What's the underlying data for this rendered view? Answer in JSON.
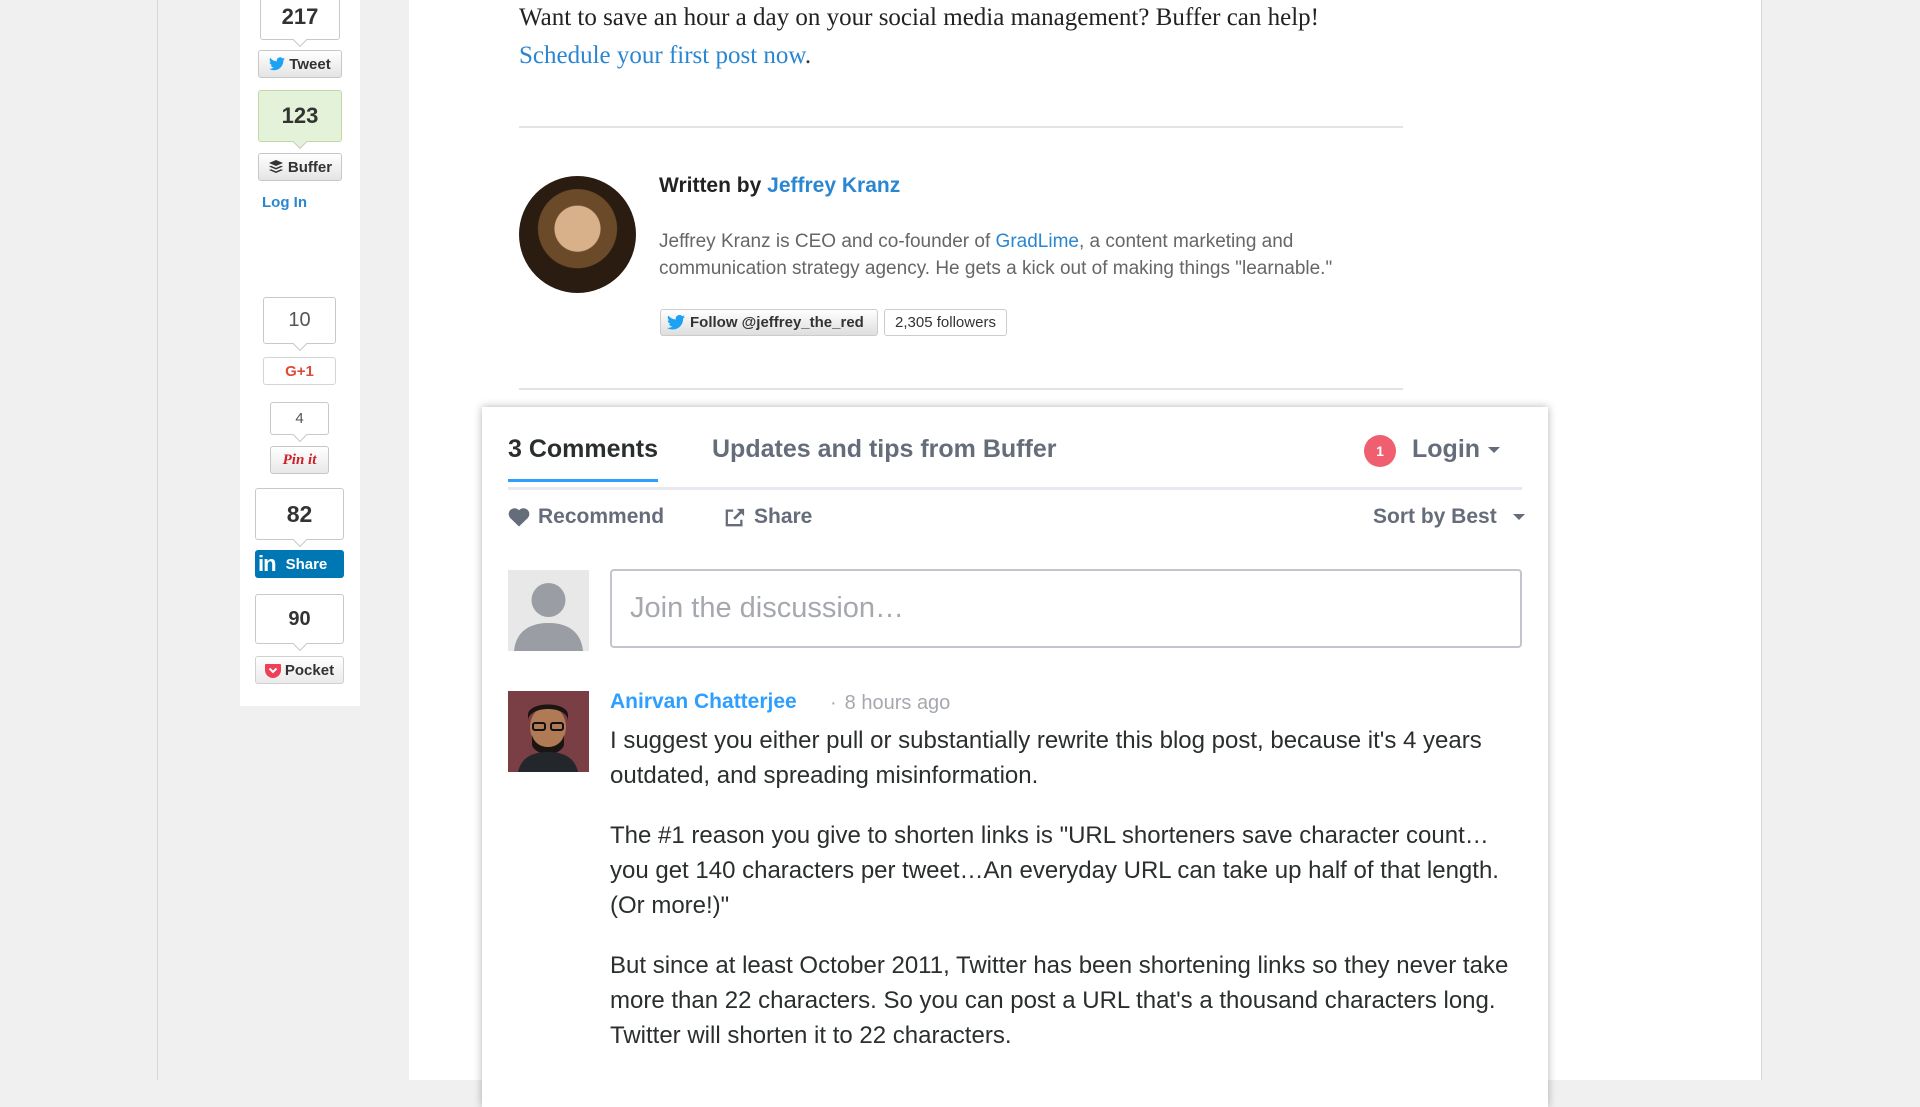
{
  "share_bar": {
    "twitter_count": "217",
    "twitter_label": "Tweet",
    "buffer_count": "123",
    "buffer_label": "Buffer",
    "login_label": "Log In",
    "gplus_count": "10",
    "gplus_label": "G+1",
    "pinterest_count": "4",
    "pinterest_label": "Pin it",
    "linkedin_count": "82",
    "linkedin_label": "Share",
    "pocket_count": "90",
    "pocket_label": "Pocket"
  },
  "article": {
    "cta_text": "Want to save an hour a day on your social media management? Buffer can help!",
    "cta_link": "Schedule your first post now",
    "cta_period": ".",
    "author": {
      "written_by": "Written by",
      "name": "Jeffrey Kranz",
      "bio_part1": "Jeffrey Kranz is CEO and co-founder of",
      "bio_company": "GradLime",
      "bio_part2": ", a content marketing and communication strategy agency. He gets a kick out of making things \"learnable.\"",
      "follow_label": "Follow @jeffrey_the_red",
      "followers": "2,305 followers"
    }
  },
  "comments": {
    "tab_count": "3 Comments",
    "tab_community": "Updates and tips from Buffer",
    "notification_count": "1",
    "login_label": "Login",
    "recommend_label": "Recommend",
    "share_label": "Share",
    "sort_label": "Sort by Best",
    "compose_placeholder": "Join the discussion…",
    "items": [
      {
        "author": "Anirvan Chatterjee",
        "separator": "·",
        "time": "8 hours ago",
        "paragraphs": [
          "I suggest you either pull or substantially rewrite this blog post, because it's 4 years outdated, and spreading misinformation.",
          "The #1 reason you give to shorten links is \"URL shorteners save character count…you get 140 characters per tweet…An everyday URL can take up half of that length. (Or more!)\"",
          "But since at least October 2011, Twitter has been shortening links so they never take more than 22 characters. So you can post a URL that's a thousand characters long. Twitter will shorten it to 22 characters."
        ]
      }
    ]
  },
  "colors": {
    "link": "#2b86d1",
    "disqus_blue": "#2e9fff",
    "badge_red": "#f05f70",
    "linkedin": "#0077b5",
    "pocket": "#ee4056"
  }
}
